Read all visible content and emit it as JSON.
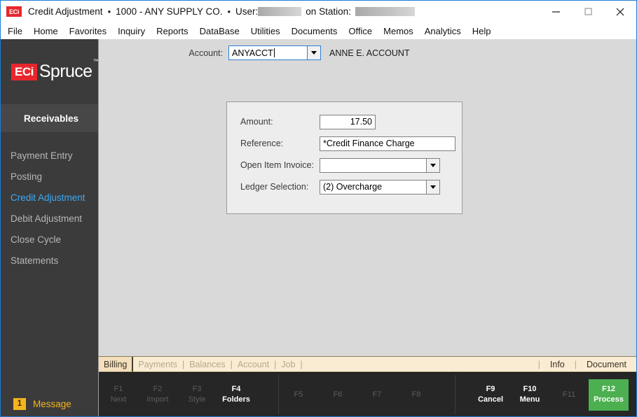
{
  "window": {
    "app_icon": "eci-logo-icon",
    "title": "Credit Adjustment",
    "sep1": "•",
    "company": "1000 - ANY SUPPLY CO.",
    "sep2": "•",
    "user_label": "User:",
    "station_label": "on Station:",
    "controls": {
      "minimize": "minimize-icon",
      "maximize": "maximize-icon",
      "close": "close-icon"
    }
  },
  "menubar": {
    "items": [
      {
        "label": "File"
      },
      {
        "label": "Home"
      },
      {
        "label": "Favorites"
      },
      {
        "label": "Inquiry"
      },
      {
        "label": "Reports"
      },
      {
        "label": "DataBase"
      },
      {
        "label": "Utilities"
      },
      {
        "label": "Documents"
      },
      {
        "label": "Office"
      },
      {
        "label": "Memos"
      },
      {
        "label": "Analytics"
      },
      {
        "label": "Help"
      }
    ]
  },
  "sidebar": {
    "logo": {
      "mark": "ECi",
      "name": "Spruce",
      "tm": "™"
    },
    "module": "Receivables",
    "items": [
      {
        "label": "Payment Entry",
        "active": false
      },
      {
        "label": "Posting",
        "active": false
      },
      {
        "label": "Credit Adjustment",
        "active": true
      },
      {
        "label": "Debit Adjustment",
        "active": false
      },
      {
        "label": "Close Cycle",
        "active": false
      },
      {
        "label": "Statements",
        "active": false
      }
    ],
    "message": {
      "count": "1",
      "label": "Message"
    },
    "accent_color": "#3fa9f5",
    "background_color": "#3b3b3b"
  },
  "form": {
    "account": {
      "label": "Account:",
      "value": "ANYACCT",
      "placeholder": "",
      "name_display": "ANNE E. ACCOUNT"
    },
    "fields": [
      {
        "label": "Amount:",
        "value": "17.50",
        "type": "text"
      },
      {
        "label": "Reference:",
        "value": "*Credit Finance Charge",
        "type": "text"
      },
      {
        "label": "Open Item Invoice:",
        "value": "",
        "type": "combo"
      },
      {
        "label": "Ledger Selection:",
        "value": "(2) Overcharge",
        "type": "combo"
      }
    ]
  },
  "tabstrip": {
    "tabs": [
      {
        "label": "Billing",
        "active": true
      },
      {
        "label": "Payments",
        "active": false
      },
      {
        "label": "Balances",
        "active": false
      },
      {
        "label": "Account",
        "active": false
      },
      {
        "label": "Job",
        "active": false
      }
    ],
    "divider": "|",
    "right_items": [
      {
        "label": "Info"
      },
      {
        "label": "Document"
      }
    ]
  },
  "fkeys": {
    "group1": [
      {
        "key": "F1",
        "label": "Next",
        "state": "disabled"
      },
      {
        "key": "F2",
        "label": "Import",
        "state": "disabled"
      },
      {
        "key": "F3",
        "label": "Style",
        "state": "disabled"
      },
      {
        "key": "F4",
        "label": "Folders",
        "state": "enabled"
      }
    ],
    "group2": [
      {
        "key": "F5",
        "label": "",
        "state": "disabled"
      },
      {
        "key": "F6",
        "label": "",
        "state": "disabled"
      },
      {
        "key": "F7",
        "label": "",
        "state": "disabled"
      },
      {
        "key": "F8",
        "label": "",
        "state": "disabled"
      }
    ],
    "group3": [
      {
        "key": "F9",
        "label": "Cancel",
        "state": "enabled"
      },
      {
        "key": "F10",
        "label": "Menu",
        "state": "enabled"
      },
      {
        "key": "F11",
        "label": "",
        "state": "disabled"
      },
      {
        "key": "F12",
        "label": "Process",
        "state": "process"
      }
    ],
    "process_color": "#4caf50"
  }
}
